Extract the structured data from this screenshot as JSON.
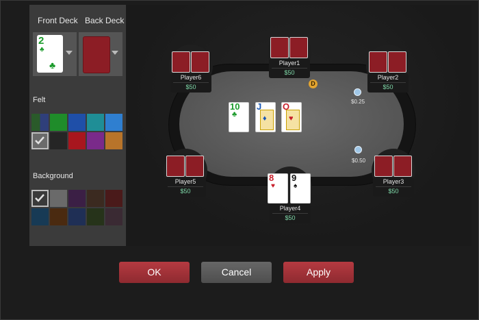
{
  "settings": {
    "front_deck_label": "Front Deck",
    "back_deck_label": "Back Deck",
    "front_deck_preview": {
      "rank": "2",
      "suit": "♣"
    },
    "felt_label": "Felt",
    "felt_colors": [
      "#2f3f7a",
      "#1f8c2a",
      "#1f4fa8",
      "#1f8e96",
      "#2f7fd0",
      "#6b6b6b",
      "#252525",
      "#a8161e",
      "#7a2a8a",
      "#b8742a"
    ],
    "felt_selected_index": 5,
    "background_label": "Background",
    "background_colors": [
      "#3a3a3a",
      "#6a6a6a",
      "#3b1f45",
      "#3b2a20",
      "#4a1a1a",
      "#173a55",
      "#4a2a10",
      "#1f2f55",
      "#26331a",
      "#3a2a33"
    ],
    "background_selected_index": 0
  },
  "table": {
    "community_cards": [
      {
        "rank": "10",
        "suit": "♣",
        "color": "#1a9a2a"
      },
      {
        "rank": "J",
        "suit": "♦",
        "color": "#1a58b5"
      },
      {
        "rank": "Q",
        "suit": "♥",
        "color": "#c81e2a"
      }
    ],
    "dealer_label": "D",
    "bets": [
      {
        "amount": "$0.25"
      },
      {
        "amount": "$0.50"
      }
    ],
    "players": [
      {
        "name": "Player1",
        "stack": "$50"
      },
      {
        "name": "Player2",
        "stack": "$50"
      },
      {
        "name": "Player3",
        "stack": "$50"
      },
      {
        "name": "Player4",
        "stack": "$50",
        "cards": [
          {
            "rank": "8",
            "suit": "♥",
            "color": "#c81e2a"
          },
          {
            "rank": "9",
            "suit": "♠",
            "color": "#111111"
          }
        ]
      },
      {
        "name": "Player5",
        "stack": "$50"
      },
      {
        "name": "Player6",
        "stack": "$50"
      }
    ]
  },
  "buttons": {
    "ok": "OK",
    "cancel": "Cancel",
    "apply": "Apply"
  }
}
